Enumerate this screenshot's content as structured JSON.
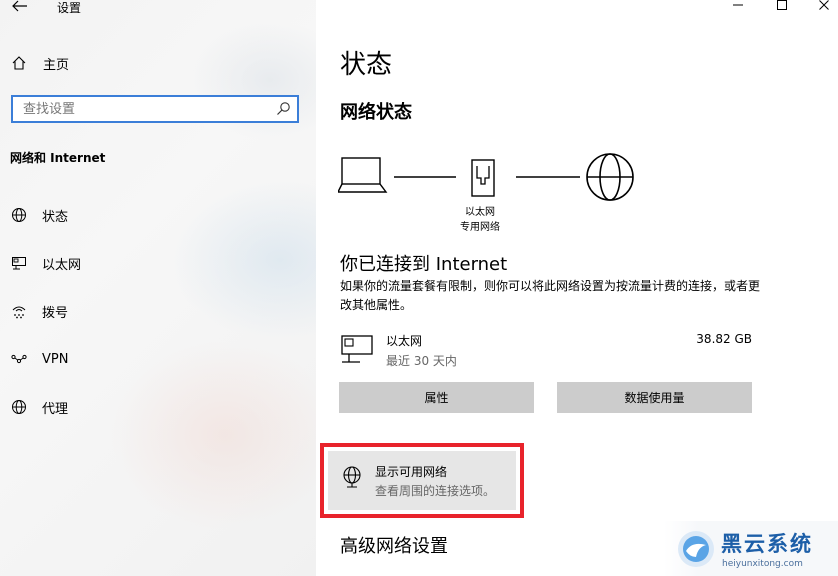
{
  "window": {
    "title": "设置",
    "controls": [
      "minimize-icon",
      "maximize-icon",
      "close-icon"
    ]
  },
  "sidebar": {
    "home_label": "主页",
    "search_placeholder": "查找设置",
    "section_title": "网络和 Internet",
    "items": [
      {
        "label": "状态",
        "icon": "globe-icon"
      },
      {
        "label": "以太网",
        "icon": "ethernet-icon"
      },
      {
        "label": "拨号",
        "icon": "dialup-icon"
      },
      {
        "label": "VPN",
        "icon": "vpn-icon"
      },
      {
        "label": "代理",
        "icon": "globe-icon"
      }
    ]
  },
  "main": {
    "page_title": "状态",
    "network_status_heading": "网络状态",
    "diagram": {
      "adapter_label": "以太网",
      "network_label": "专用网络"
    },
    "connected_title": "你已连接到 Internet",
    "connected_desc": "如果你的流量套餐有限制，则你可以将此网络设置为按流量计费的连接，或者更改其他属性。",
    "ethernet": {
      "name": "以太网",
      "period": "最近 30 天内",
      "usage": "38.82 GB"
    },
    "buttons": {
      "properties": "属性",
      "data_usage": "数据使用量"
    },
    "show_networks": {
      "title": "显示可用网络",
      "subtitle": "查看周围的连接选项。",
      "highlight_color": "#e8232b"
    },
    "advanced_heading": "高级网络设置"
  },
  "watermark": {
    "brand": "黑云系统",
    "url": "heiyunxitong.com"
  },
  "colors": {
    "accent": "#3b7ed8",
    "button_bg": "#cccccc",
    "highlight": "#e8232b"
  }
}
